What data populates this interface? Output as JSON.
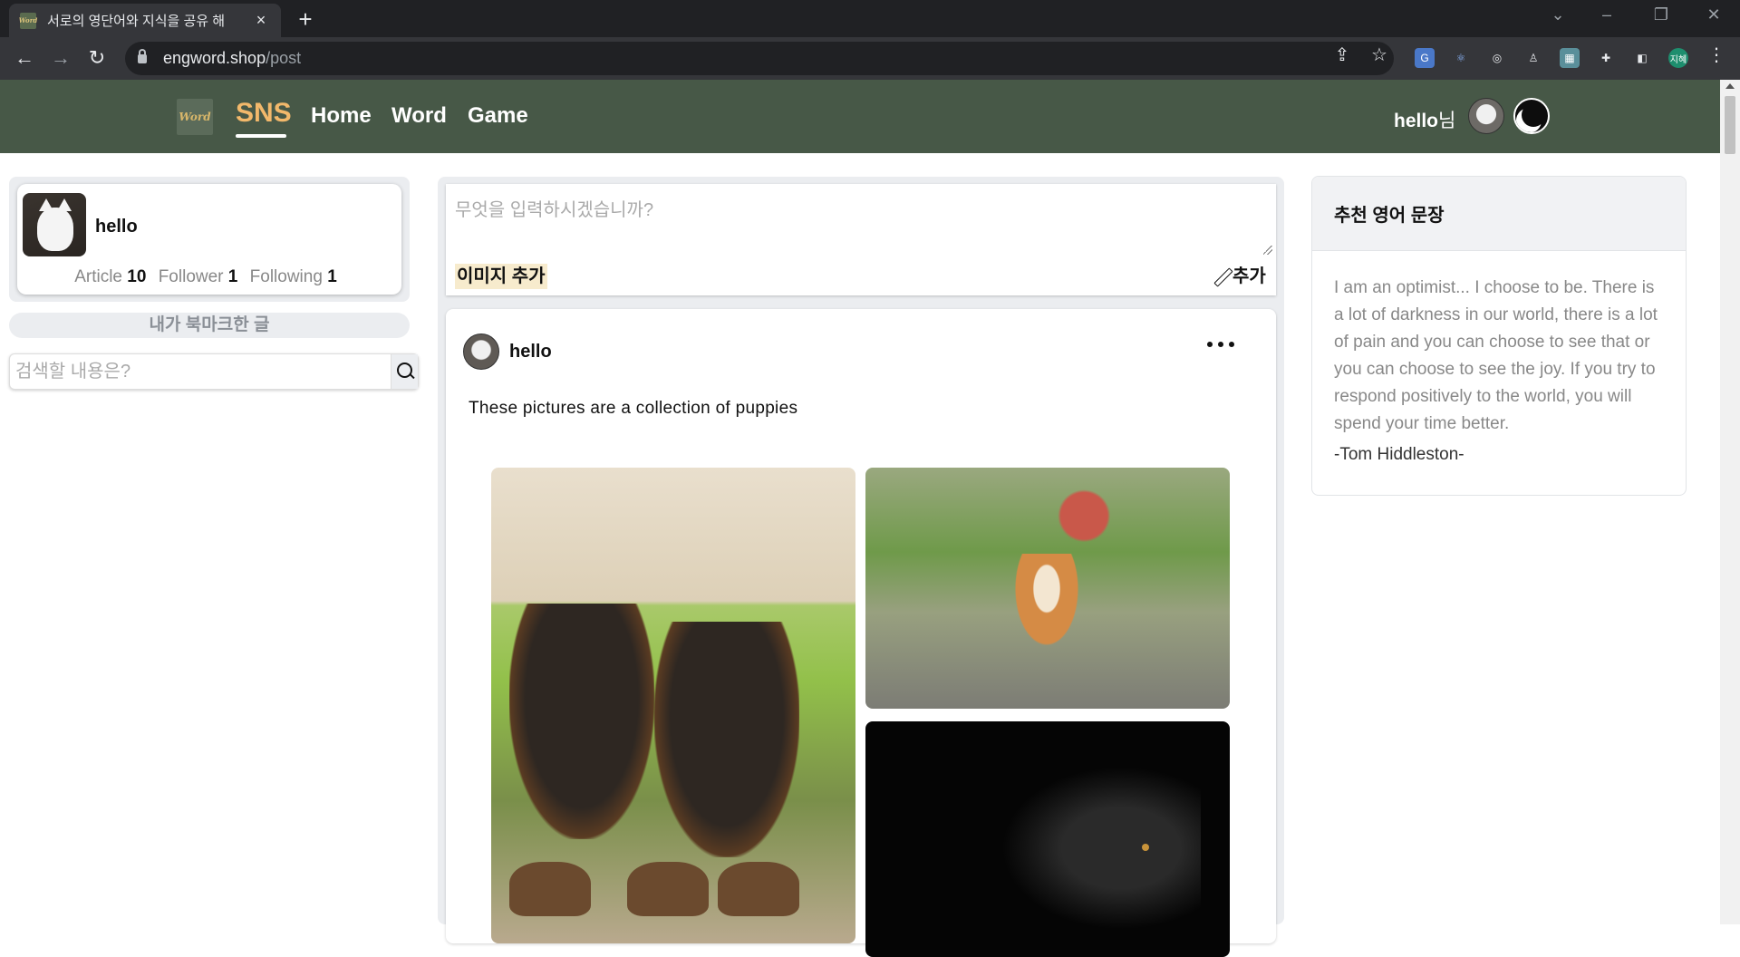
{
  "browser": {
    "tab_title": "서로의 영단어와 지식을 공유 해",
    "favicon_text": "Word",
    "url_host": "engword.shop",
    "url_path": "/post",
    "profile_ext_label": "지혜"
  },
  "header": {
    "logo_text": "Word",
    "nav": [
      {
        "label": "SNS",
        "active": true
      },
      {
        "label": "Home",
        "active": false
      },
      {
        "label": "Word",
        "active": false
      },
      {
        "label": "Game",
        "active": false
      }
    ],
    "greeting_name": "hello",
    "greeting_suffix": "님"
  },
  "profile": {
    "name": "hello",
    "article_label": "Article",
    "article_count": "10",
    "follower_label": "Follower",
    "follower_count": "1",
    "following_label": "Following",
    "following_count": "1"
  },
  "sidebar": {
    "bookmark_label": "내가 북마크한 글",
    "search_placeholder": "검색할 내용은?"
  },
  "composer": {
    "placeholder": "무엇을 입력하시겠습니까?",
    "add_image_label": "이미지 추가",
    "add_label": "추가"
  },
  "post": {
    "author": "hello",
    "text": "These pictures are a collection of puppies"
  },
  "quote": {
    "title": "추천 영어 문장",
    "text": "I am an optimist... I choose to be. There is a lot of darkness in our world, there is a lot of pain and you can choose to see that or you can choose to see the joy. If you try to respond positively to the world, you will spend your time better.",
    "author": "-Tom Hiddleston-"
  },
  "colors": {
    "header_bg": "#475847",
    "nav_active": "#f2b86b"
  }
}
